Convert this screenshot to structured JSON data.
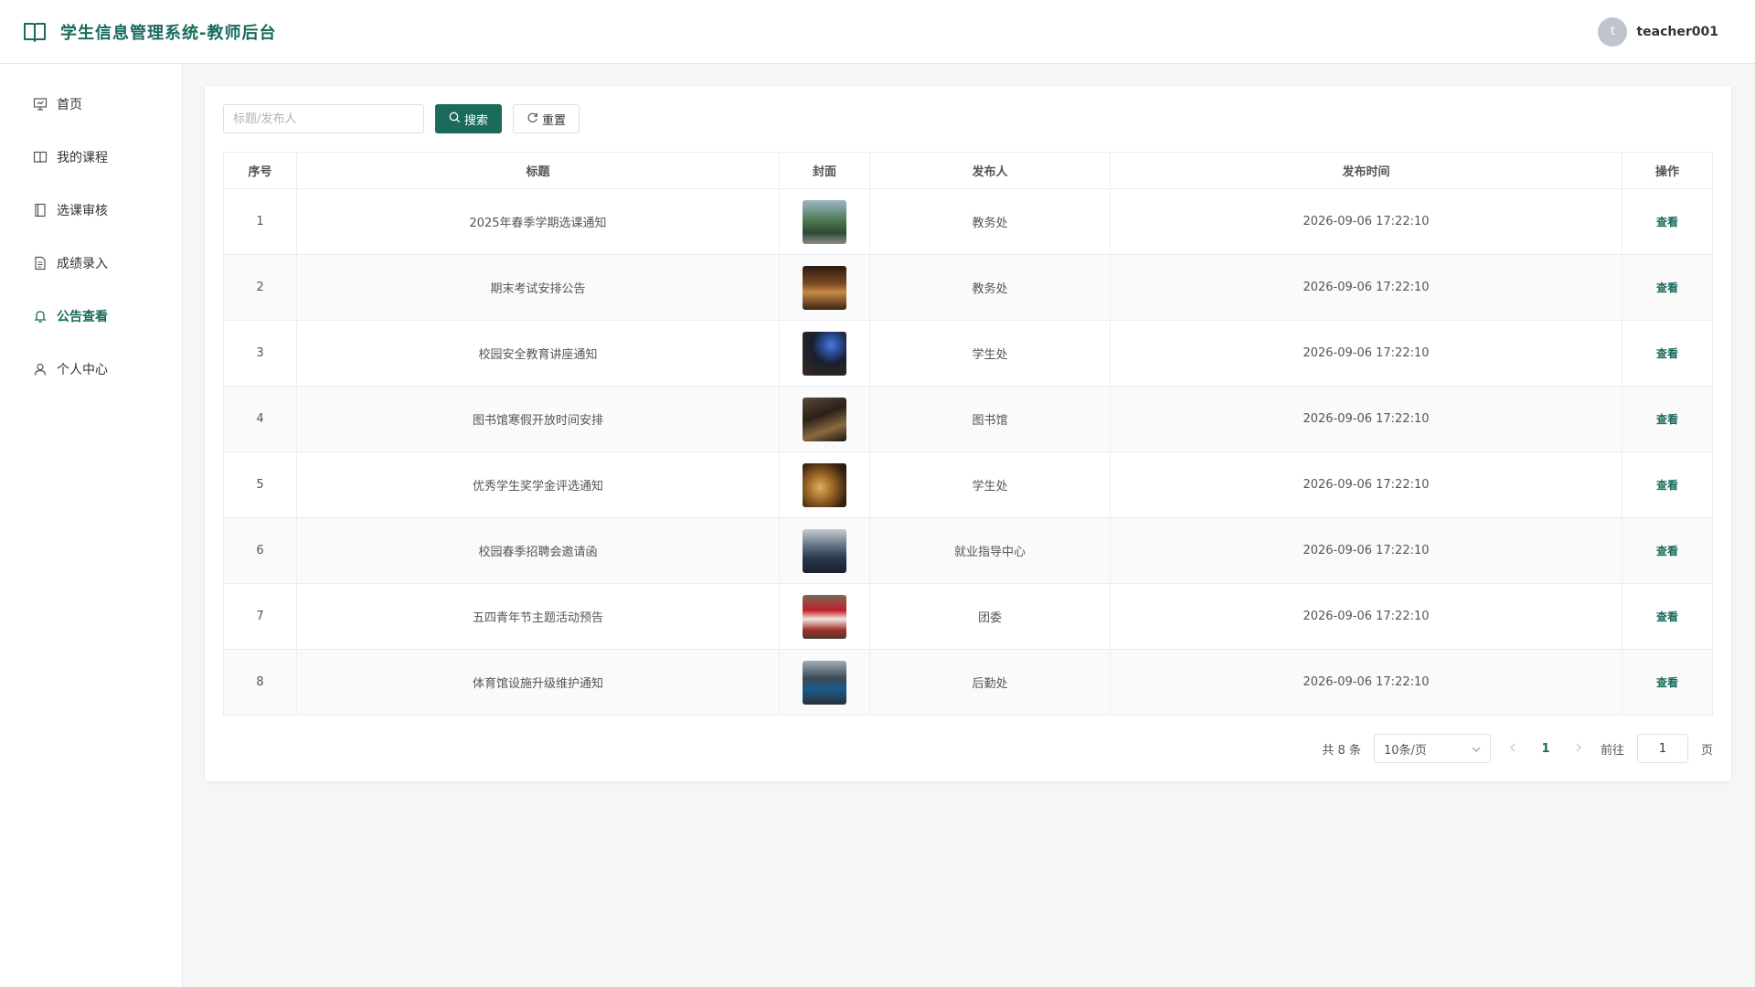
{
  "header": {
    "title": "学生信息管理系统-教师后台",
    "username": "teacher001",
    "avatar_letter": "t"
  },
  "sidebar": {
    "items": [
      {
        "label": "首页",
        "icon": "presentation-icon"
      },
      {
        "label": "我的课程",
        "icon": "book-icon"
      },
      {
        "label": "选课审核",
        "icon": "notebook-icon"
      },
      {
        "label": "成绩录入",
        "icon": "document-icon"
      },
      {
        "label": "公告查看",
        "icon": "bell-icon",
        "active": true
      },
      {
        "label": "个人中心",
        "icon": "user-icon"
      }
    ]
  },
  "toolbar": {
    "search_placeholder": "标题/发布人",
    "search_label": "搜索",
    "reset_label": "重置"
  },
  "table": {
    "columns": [
      "序号",
      "标题",
      "封面",
      "发布人",
      "发布时间",
      "操作"
    ],
    "action_label": "查看",
    "rows": [
      {
        "no": "1",
        "title": "2025年春季学期选课通知",
        "publisher": "教务处",
        "time": "2026-09-06 17:22:10"
      },
      {
        "no": "2",
        "title": "期末考试安排公告",
        "publisher": "教务处",
        "time": "2026-09-06 17:22:10"
      },
      {
        "no": "3",
        "title": "校园安全教育讲座通知",
        "publisher": "学生处",
        "time": "2026-09-06 17:22:10"
      },
      {
        "no": "4",
        "title": "图书馆寒假开放时间安排",
        "publisher": "图书馆",
        "time": "2026-09-06 17:22:10"
      },
      {
        "no": "5",
        "title": "优秀学生奖学金评选通知",
        "publisher": "学生处",
        "time": "2026-09-06 17:22:10"
      },
      {
        "no": "6",
        "title": "校园春季招聘会邀请函",
        "publisher": "就业指导中心",
        "time": "2026-09-06 17:22:10"
      },
      {
        "no": "7",
        "title": "五四青年节主题活动预告",
        "publisher": "团委",
        "time": "2026-09-06 17:22:10"
      },
      {
        "no": "8",
        "title": "体育馆设施升级维护通知",
        "publisher": "后勤处",
        "time": "2026-09-06 17:22:10"
      }
    ]
  },
  "pagination": {
    "total": "共 8 条",
    "page_size": "10条/页",
    "current_page": "1",
    "goto_label": "前往",
    "goto_value": "1",
    "page_suffix": "页"
  },
  "colors": {
    "primary": "#1a6b5c"
  }
}
